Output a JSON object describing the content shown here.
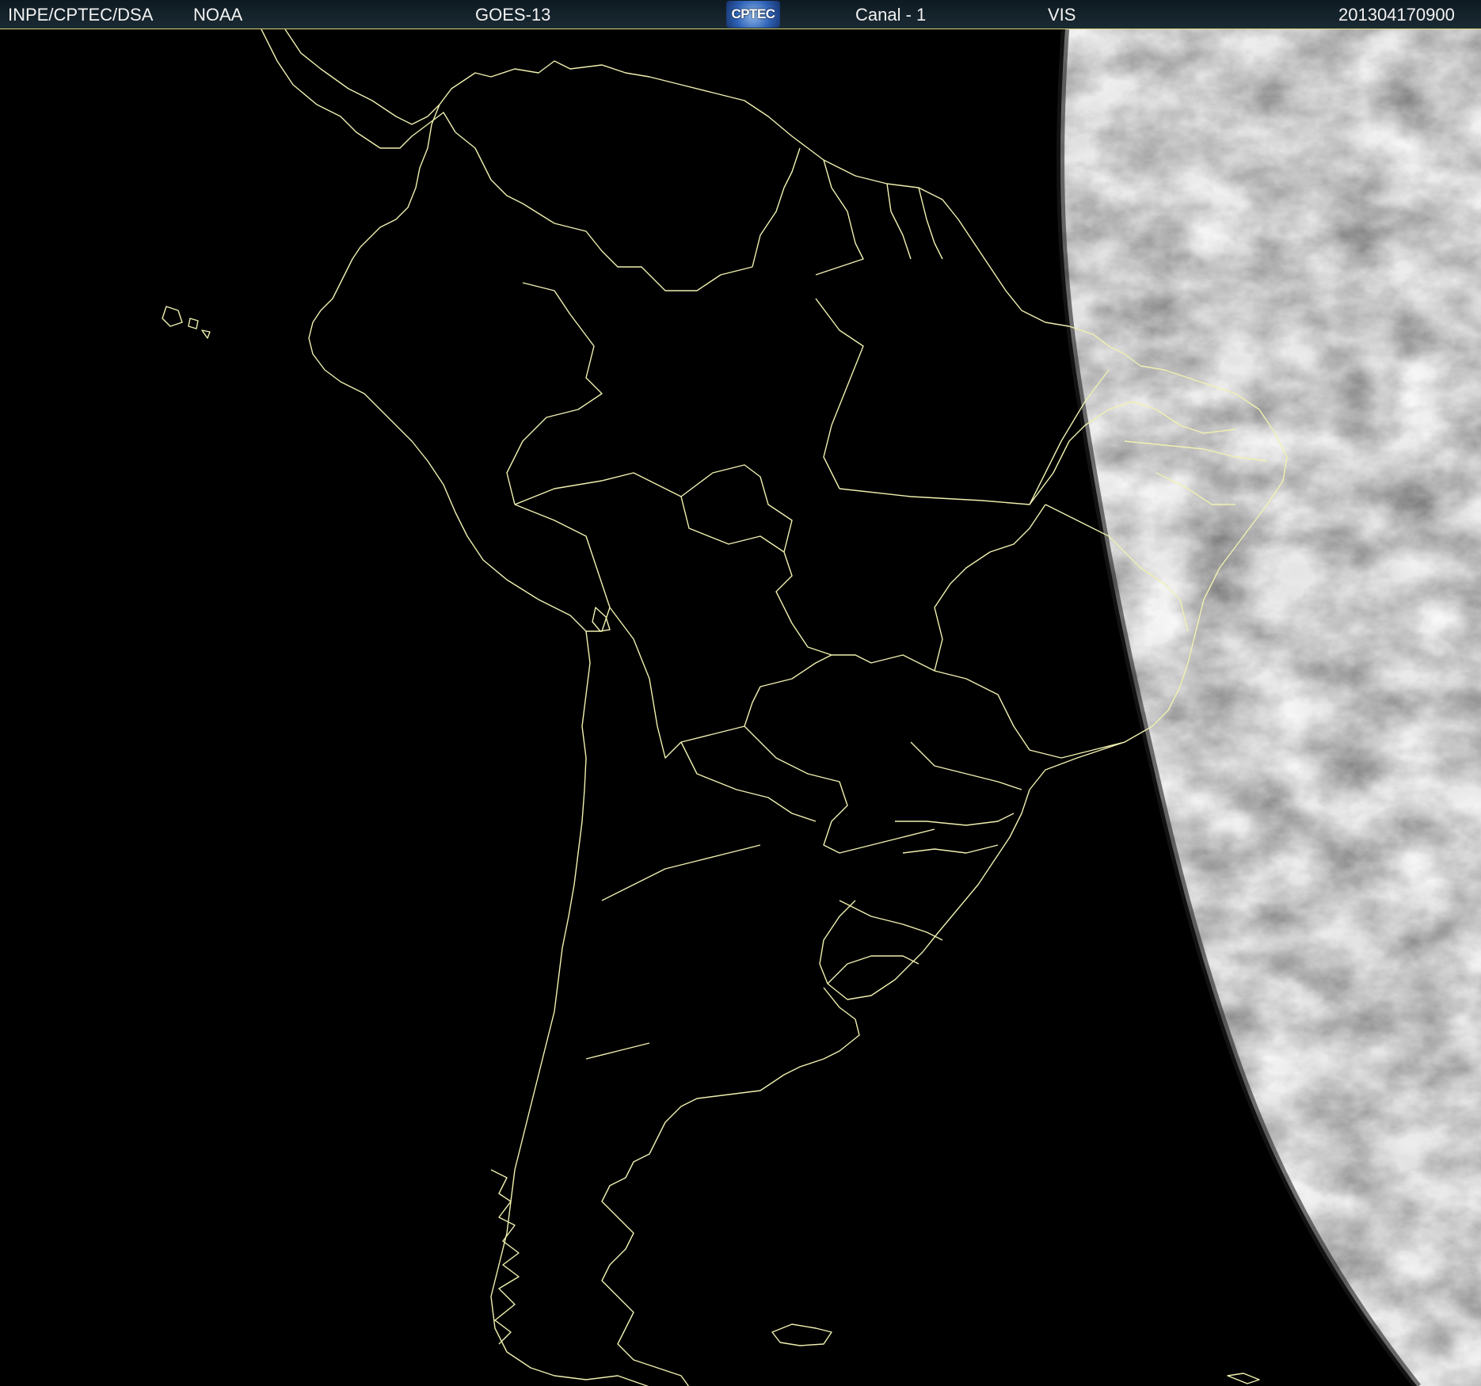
{
  "header": {
    "institution": "INPE/CPTEC/DSA",
    "agency": "NOAA",
    "satellite": "GOES-13",
    "logo_text": "CPTEC",
    "channel": "Canal - 1",
    "band": "VIS",
    "timestamp": "201304170900"
  },
  "image": {
    "background_color": "#000000",
    "boundary_color": "#f0f0b0",
    "cloud_color": "#c8c8c8",
    "icon": "terminator-illuminated-globe"
  }
}
